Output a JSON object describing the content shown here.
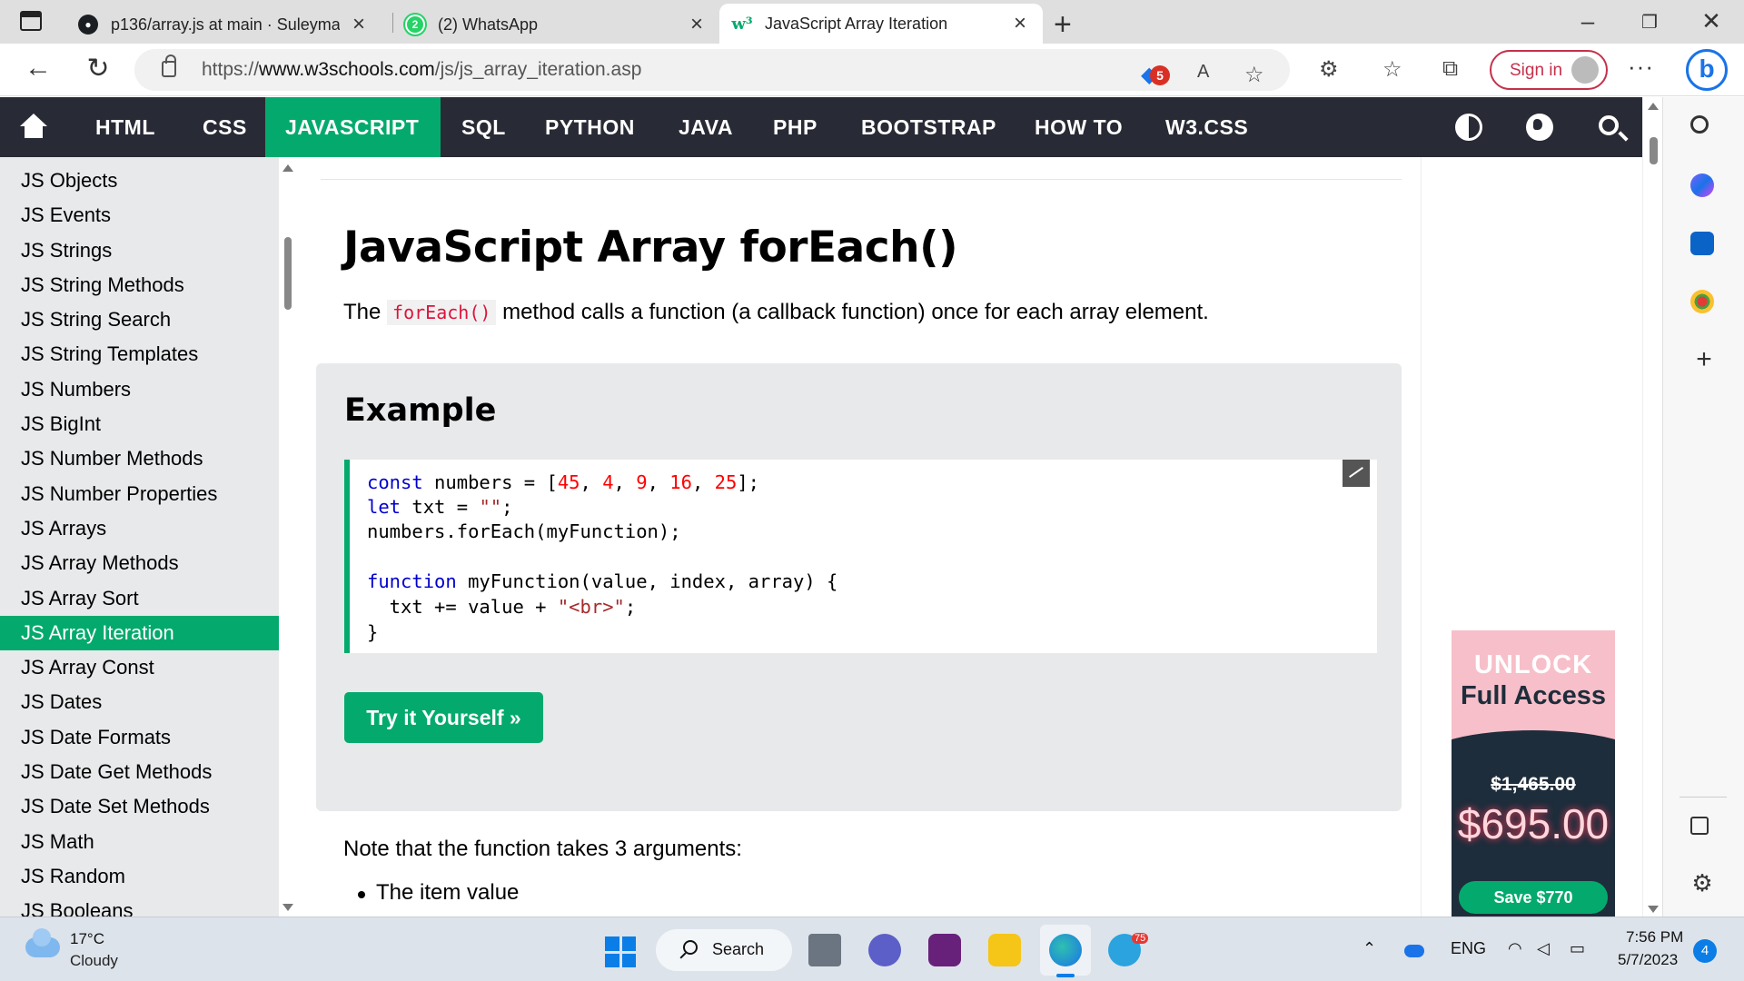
{
  "browser": {
    "tabs": [
      {
        "title": "p136/array.js at main · Suleyman",
        "favicon": "github-icon"
      },
      {
        "title": "(2) WhatsApp",
        "favicon": "whatsapp-icon",
        "badge": "2"
      },
      {
        "title": "JavaScript Array Iteration",
        "favicon": "w3schools-icon"
      }
    ],
    "url_prefix": "https://",
    "url_domain": "www.w3schools.com",
    "url_path": "/js/js_array_iteration.asp",
    "extension_badge": "5",
    "read_aloud": "A",
    "sign_in": "Sign in"
  },
  "topnav": {
    "items": [
      "HTML",
      "CSS",
      "JAVASCRIPT",
      "SQL",
      "PYTHON",
      "JAVA",
      "PHP",
      "BOOTSTRAP",
      "HOW TO",
      "W3.CSS"
    ],
    "active": "JAVASCRIPT"
  },
  "sidebar": {
    "items": [
      "JS Objects",
      "JS Events",
      "JS Strings",
      "JS String Methods",
      "JS String Search",
      "JS String Templates",
      "JS Numbers",
      "JS BigInt",
      "JS Number Methods",
      "JS Number Properties",
      "JS Arrays",
      "JS Array Methods",
      "JS Array Sort",
      "JS Array Iteration",
      "JS Array Const",
      "JS Dates",
      "JS Date Formats",
      "JS Date Get Methods",
      "JS Date Set Methods",
      "JS Math",
      "JS Random",
      "JS Booleans"
    ],
    "active": "JS Array Iteration"
  },
  "content": {
    "title": "JavaScript Array forEach()",
    "intro_before": "The ",
    "intro_code": "forEach()",
    "intro_after": " method calls a function (a callback function) once for each array element.",
    "example_heading": "Example",
    "code": {
      "l1_kw": "const",
      "l1_rest": " numbers = [",
      "l1_n1": "45",
      "l1_n2": "4",
      "l1_n3": "9",
      "l1_n4": "16",
      "l1_n5": "25",
      "l2_kw": "let",
      "l2_rest": " txt = ",
      "l2_str": "\"\"",
      "l3": "numbers.forEach(myFunction);",
      "l4_kw": "function",
      "l4_rest": " myFunction(value, index, array) {",
      "l5_rest": "  txt += value + ",
      "l5_str": "\"<br>\"",
      "l6": "}"
    },
    "try_button": "Try it Yourself »",
    "note": "Note that the function takes 3 arguments:",
    "bullet": "The item value"
  },
  "ad": {
    "line1": "UNLOCK",
    "line2": "Full Access",
    "old_price": "$1,465.00",
    "new_price": "$695.00",
    "button": "Save $770"
  },
  "taskbar": {
    "temperature": "17°C",
    "condition": "Cloudy",
    "search": "Search",
    "telegram_badge": "75",
    "language": "ENG",
    "time": "7:56 PM",
    "date": "5/7/2023",
    "notifications": "4"
  },
  "colors": {
    "w3_green": "#04aa6d",
    "nav_dark": "#282a35",
    "sidebar_bg": "#e7e9eb",
    "code_keyword": "#0000cd",
    "code_number": "#ff0000",
    "code_string": "#a52a2a"
  }
}
